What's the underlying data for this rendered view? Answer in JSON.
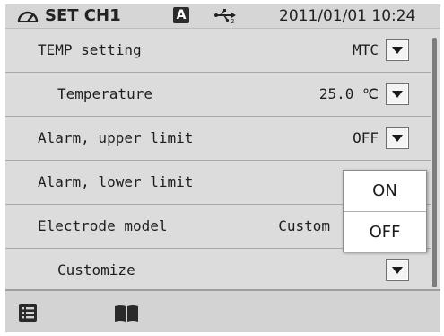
{
  "status": {
    "title": "SET CH1",
    "auto_badge": "A",
    "datetime": "2011/01/01 10:24",
    "meter_icon": "meter-icon",
    "usb_icon": "usb-icon"
  },
  "rows": [
    {
      "label": "TEMP setting",
      "value": "MTC",
      "has_dropdown": true
    },
    {
      "label": "Temperature",
      "value": "25.0 ℃",
      "has_dropdown": true
    },
    {
      "label": "Alarm, upper limit",
      "value": "OFF",
      "has_dropdown": true
    },
    {
      "label": "Alarm, lower limit",
      "value": "",
      "has_dropdown": false
    },
    {
      "label": "Electrode model",
      "value": "Custom",
      "has_dropdown": false
    },
    {
      "label": "Customize",
      "value": "",
      "has_dropdown": true
    }
  ],
  "popup": {
    "options": [
      "ON",
      "OFF"
    ]
  },
  "bottom_bar": {
    "icons": [
      "menu-list-icon",
      "book-icon"
    ]
  },
  "colors": {
    "background": "#dcdcdc",
    "popup_bg": "#ffffff",
    "text": "#1e1e1e"
  }
}
